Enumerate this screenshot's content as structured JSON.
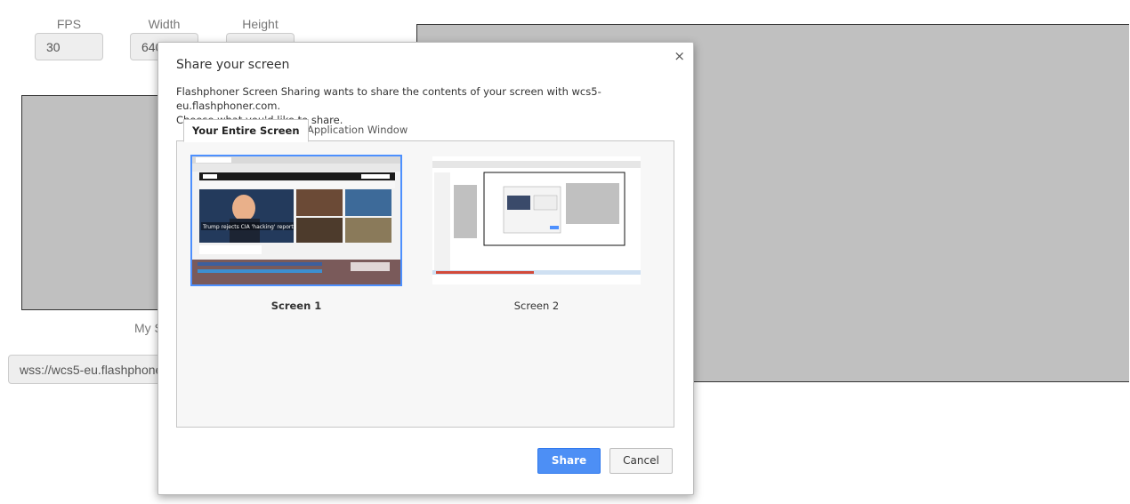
{
  "page": {
    "fields": [
      {
        "label": "FPS",
        "value": "30"
      },
      {
        "label": "Width",
        "value": "640"
      },
      {
        "label": "Height",
        "value": ""
      }
    ],
    "local_video_caption": "My S",
    "server_url": "wss://wcs5-eu.flashphoner.com"
  },
  "dialog": {
    "title": "Share your screen",
    "close_glyph": "×",
    "description_line1": "Flashphoner Screen Sharing wants to share the contents of your screen with wcs5-eu.flashphoner.com.",
    "description_line2": "Choose what you'd like to share.",
    "tabs": [
      {
        "label": "Your Entire Screen",
        "active": true
      },
      {
        "label": "Application Window",
        "active": false
      }
    ],
    "screens": [
      {
        "label": "Screen 1",
        "selected": true,
        "headline": "Trump rejects CIA 'hacking' report"
      },
      {
        "label": "Screen 2",
        "selected": false
      }
    ],
    "share_label": "Share",
    "cancel_label": "Cancel"
  },
  "colors": {
    "accent": "#4d90fe",
    "video_placeholder": "#c0c0c0"
  }
}
